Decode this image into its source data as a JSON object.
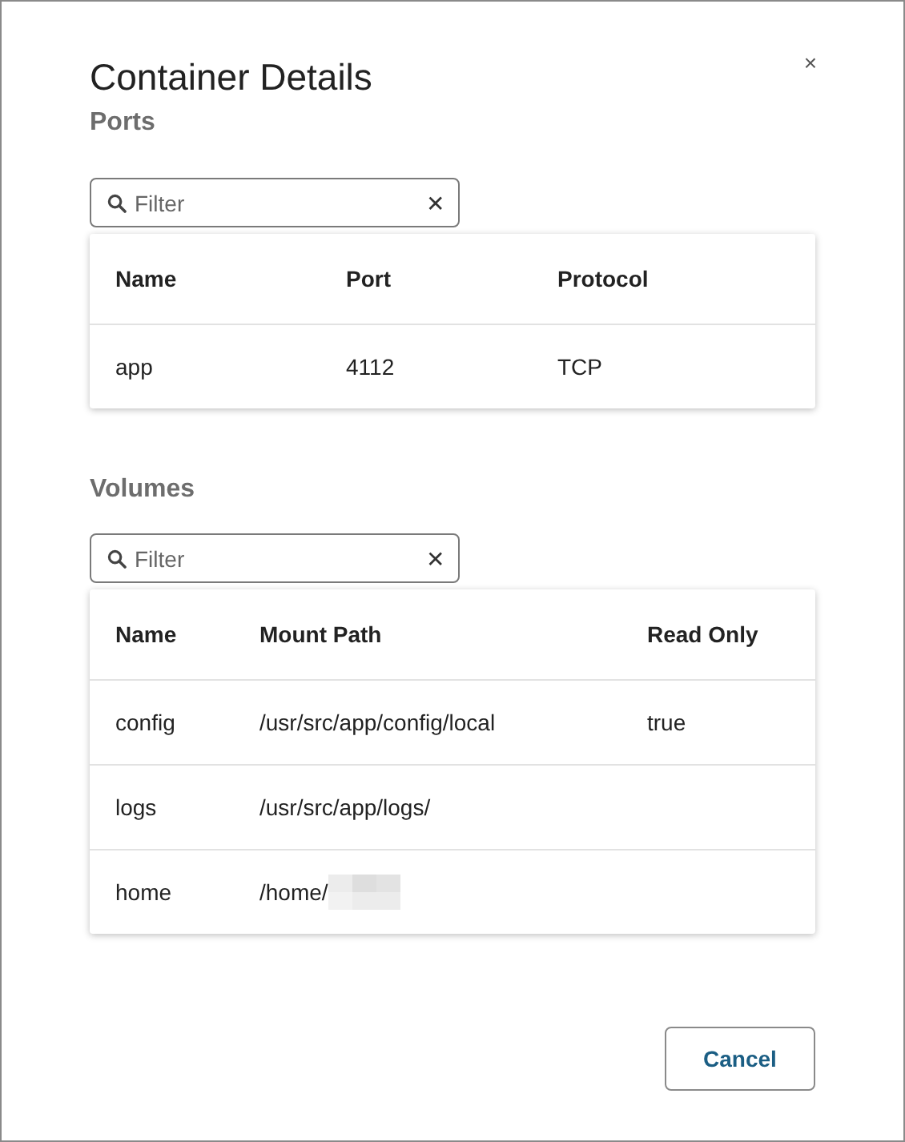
{
  "dialog": {
    "title": "Container Details",
    "close": "×"
  },
  "ports": {
    "heading": "Ports",
    "filter": {
      "placeholder": "Filter",
      "clear": "✕"
    },
    "columns": [
      "Name",
      "Port",
      "Protocol"
    ],
    "rows": [
      {
        "cells": [
          "app",
          "4112",
          "TCP"
        ],
        "redacted": false
      }
    ]
  },
  "volumes": {
    "heading": "Volumes",
    "filter": {
      "placeholder": "Filter",
      "clear": "✕"
    },
    "columns": [
      "Name",
      "Mount Path",
      "Read Only"
    ],
    "rows": [
      {
        "cells": [
          "config",
          "/usr/src/app/config/local",
          "true"
        ],
        "redacted": false
      },
      {
        "cells": [
          "logs",
          "/usr/src/app/logs/"
        ],
        "redacted": false
      },
      {
        "cells": [
          "home",
          "/home/"
        ],
        "redacted": true
      }
    ]
  },
  "buttons": [
    "Cancel"
  ]
}
